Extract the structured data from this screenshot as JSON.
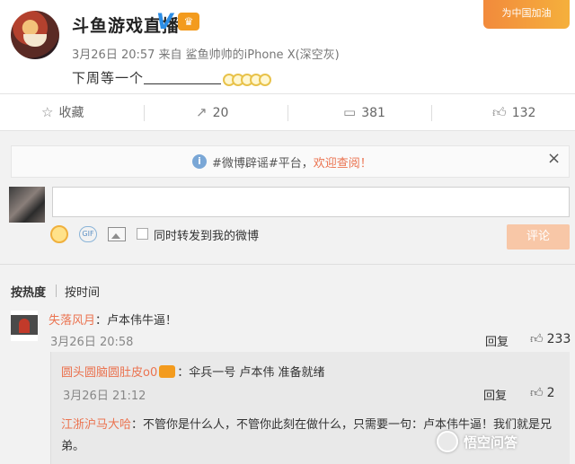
{
  "post": {
    "author": "斗鱼游戏直播",
    "verified_mark": "V",
    "meta": "3月26日 20:57 来自 鲨鱼帅帅的iPhone X(深空灰)",
    "text_prefix": "下周等一个",
    "corner_badge": "为中国加油"
  },
  "actions": {
    "favorite_label": "收藏",
    "forward_count": "20",
    "comment_count": "381",
    "like_count": "132"
  },
  "notice": {
    "text_before": "#微博辟谣#平台，",
    "text_link": "欢迎查阅！",
    "close": "×"
  },
  "composer": {
    "sync_label": "同时转发到我的微博",
    "submit_label": "评论",
    "gif_label": "GIF"
  },
  "sort": {
    "hot": "按热度",
    "time": "按时间"
  },
  "comments": [
    {
      "user": "失落风月",
      "text": "：卢本伟牛逼！",
      "time": "3月26日 20:58",
      "reply_label": "回复",
      "likes": "233"
    }
  ],
  "replies": [
    {
      "user": "圆头圆脑圆肚皮o0",
      "text": "：伞兵一号 卢本伟 准备就绪",
      "time": "3月26日 21:12",
      "reply_label": "回复",
      "likes": "2"
    },
    {
      "user": "江浙沪马大哈",
      "text": "：不管你是什么人，不管你此刻在做什么，只需要一句：卢本伟牛逼！我们就是兄弟。"
    }
  ],
  "watermark": "悟空问答",
  "colors": {
    "link": "#eb7350",
    "verified": "#2d8ee6",
    "submit_disabled": "#f8c7a7"
  }
}
